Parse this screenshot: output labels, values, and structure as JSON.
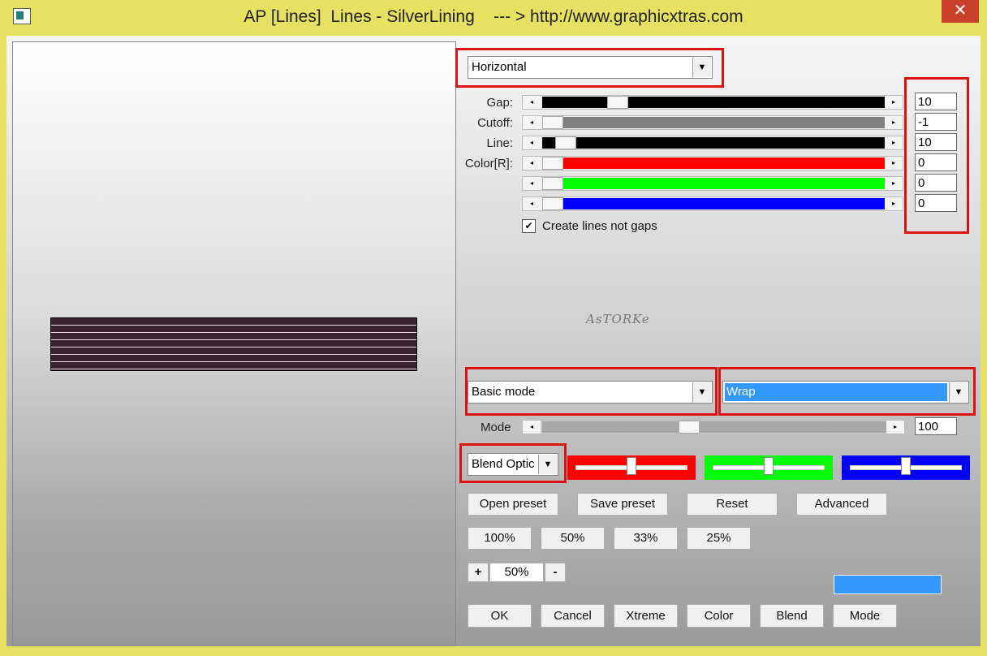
{
  "window": {
    "title": "AP [Lines]  Lines - SilverLining    --- > http://www.graphicxtras.com",
    "close_glyph": "✕"
  },
  "direction": {
    "selected": "Horizontal"
  },
  "sliders": [
    {
      "label": "Gap:",
      "value": "10",
      "color": "#000000"
    },
    {
      "label": "Cutoff:",
      "value": "-1",
      "color": "#808080"
    },
    {
      "label": "Line:",
      "value": "10",
      "color": "#000000"
    },
    {
      "label": "Color[R]:",
      "value": "0",
      "color": "#ff0000"
    },
    {
      "label": "",
      "value": "0",
      "color": "#00ff00"
    },
    {
      "label": "",
      "value": "0",
      "color": "#0000ff"
    }
  ],
  "create_lines": {
    "label": "Create lines not gaps",
    "checked": true
  },
  "watermark": "AsTORKe",
  "mode_select": {
    "selected": "Basic mode"
  },
  "wrap_select": {
    "selected": "Wrap"
  },
  "mode_slider": {
    "label": "Mode",
    "value": "100"
  },
  "blend_options": {
    "selected": "Blend Optic"
  },
  "preset_buttons": {
    "open": "Open preset",
    "save": "Save preset",
    "reset": "Reset",
    "advanced": "Advanced"
  },
  "zoom_buttons": [
    "100%",
    "50%",
    "33%",
    "25%"
  ],
  "zoom": {
    "plus": "+",
    "value": "50%",
    "minus": "-"
  },
  "action_buttons": [
    "OK",
    "Cancel",
    "Xtreme",
    "Color",
    "Blend",
    "Mode"
  ],
  "icons": {
    "dropdown": "dropdown-arrow-icon",
    "checkmark": "checkmark-icon",
    "close": "close-icon",
    "app": "app-icon"
  },
  "colors": {
    "titlebar": "#e6e063",
    "highlight": "#3399ff",
    "red": "#ff0000",
    "green": "#00ff00",
    "blue": "#0000ff"
  }
}
